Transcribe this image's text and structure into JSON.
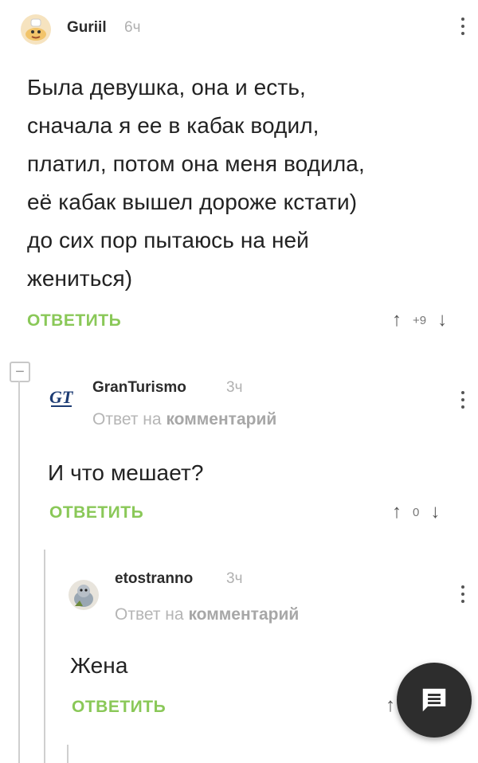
{
  "comments": [
    {
      "username": "Guriil",
      "time": "6ч",
      "text_lines": [
        "Была девушка, она и есть,",
        "сначала я ее в кабак водил,",
        "платил, потом она меня водила,",
        "её кабак вышел дороже кстати)",
        "до сих пор пытаюсь на ней",
        "жениться)"
      ],
      "reply_label": "ОТВЕТИТЬ",
      "rating": "+9"
    },
    {
      "username": "GranTurismo",
      "time": "3ч",
      "reply_to_prefix": "Ответ на",
      "reply_to_target": "комментарий",
      "text_lines": [
        "И что мешает?"
      ],
      "reply_label": "ОТВЕТИТЬ",
      "rating": "0"
    },
    {
      "username": "etostranno",
      "time": "3ч",
      "reply_to_prefix": "Ответ на",
      "reply_to_target": "комментарий",
      "text_lines": [
        "Жена"
      ],
      "reply_label": "ОТВЕТИТЬ"
    }
  ],
  "collapse_symbol": "−",
  "arrows": {
    "up": "↑",
    "down": "↓"
  },
  "icons": {
    "kebab": "more-vertical",
    "fab": "comment-icon",
    "avatar1": "cartoon-avatar",
    "avatar2": "gt-logo",
    "avatar3": "animal-avatar"
  },
  "colors": {
    "accent_green": "#8ac858",
    "fab_bg": "#2d2d2d",
    "branch_line": "#cfcfcf"
  }
}
